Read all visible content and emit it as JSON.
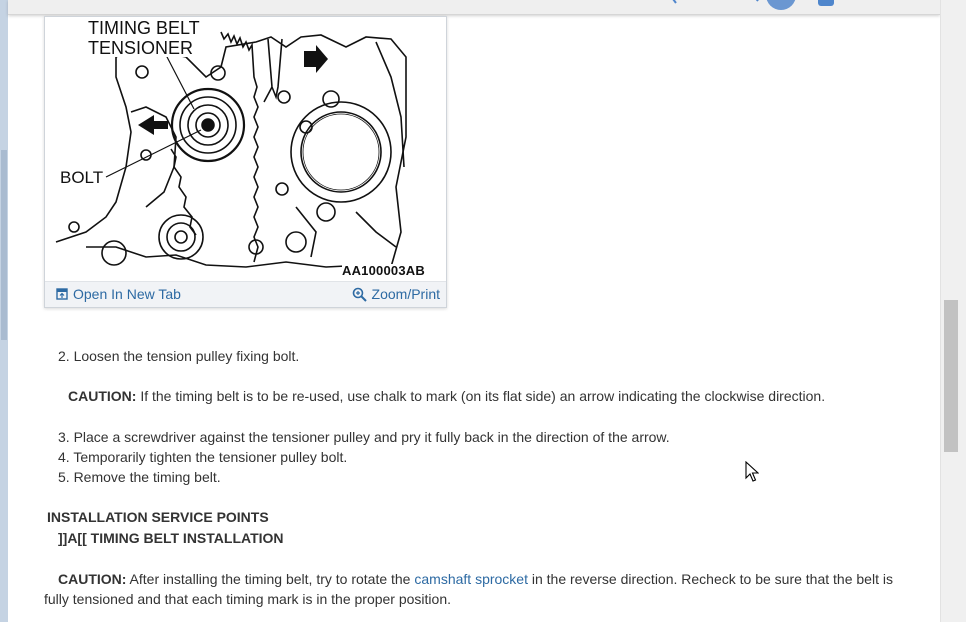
{
  "figure": {
    "label_tensioner_line1": "TIMING BELT",
    "label_tensioner_line2": "TENSIONER",
    "label_bolt": "BOLT",
    "image_code": "AA100003AB",
    "open_new_tab": "Open In New Tab",
    "zoom_print": "Zoom/Print"
  },
  "steps": {
    "step2": "2. Loosen the tension pulley fixing bolt.",
    "caution1_label": "CAUTION:",
    "caution1_text": " If the timing belt is to be re-used, use chalk to mark (on its flat side) an arrow indicating the clockwise direction.",
    "step3": "3. Place a screwdriver against the tensioner pulley and pry it fully back in the direction of the arrow.",
    "step4": "4. Temporarily tighten the tensioner pulley bolt.",
    "step5": "5. Remove the timing belt."
  },
  "installation": {
    "heading": "INSTALLATION SERVICE POINTS",
    "subheading": "]]A[[ TIMING BELT INSTALLATION",
    "caution_label": "CAUTION:",
    "caution_text_before": " After installing the timing belt, try to rotate the ",
    "caution_link": "camshaft sprocket",
    "caution_text_after": " in the reverse direction. Recheck to be sure that the belt is fully tensioned and that each timing mark is in the proper position."
  },
  "colors": {
    "link": "#2d6aa3",
    "text": "#333333",
    "accent_avatar": "#6b97d1"
  }
}
